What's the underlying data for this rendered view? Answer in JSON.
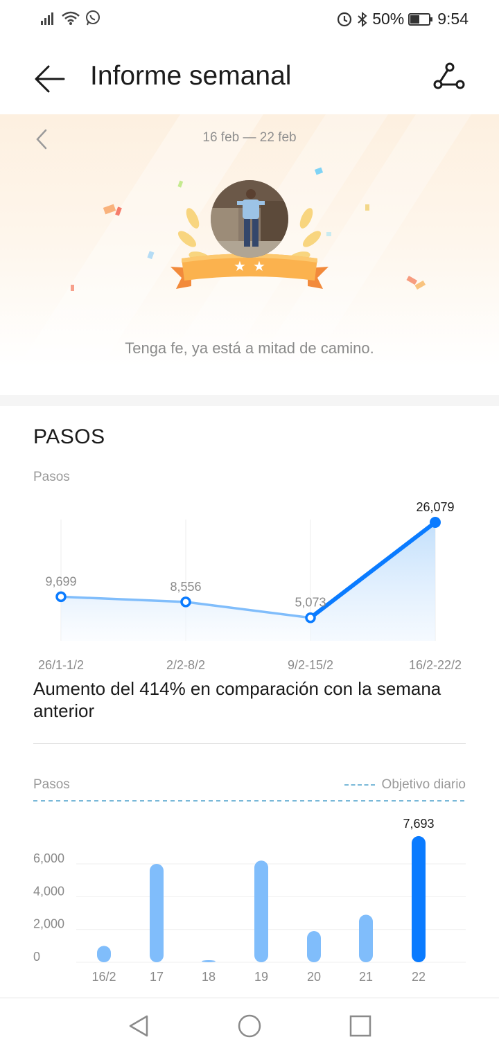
{
  "status_bar": {
    "battery": "50%",
    "time": "9:54",
    "icons": [
      "signal-icon",
      "wifi-icon",
      "whatsapp-icon",
      "data-saver-icon",
      "bluetooth-icon",
      "battery-icon"
    ]
  },
  "header": {
    "title": "Informe semanal",
    "back_icon": "arrow-left-icon",
    "share_icon": "route-share-icon"
  },
  "banner": {
    "date_range": "16 feb — 22 feb",
    "stars_earned": 2,
    "message": "Tenga fe, ya está a mitad de camino."
  },
  "steps_section": {
    "title": "PASOS",
    "line_unit": "Pasos",
    "comparison": "Aumento del 414% en comparación con la semana anterior",
    "bar_unit": "Pasos",
    "goal_legend": "Objetivo diario"
  },
  "chart_data": [
    {
      "type": "line",
      "ylabel": "Pasos",
      "categories": [
        "26/1-1/2",
        "2/2-8/2",
        "9/2-15/2",
        "16/2-22/2"
      ],
      "values": [
        9699,
        8556,
        5073,
        26079
      ],
      "value_labels": [
        "9,699",
        "8,556",
        "5,073",
        "26,079"
      ],
      "highlight_index": 3
    },
    {
      "type": "bar",
      "ylabel": "Pasos",
      "categories": [
        "16/2",
        "17",
        "18",
        "19",
        "20",
        "21",
        "22"
      ],
      "values": [
        1000,
        6000,
        50,
        6200,
        1900,
        2900,
        7693
      ],
      "highlight_index": 6,
      "highlight_label": "7,693",
      "y_ticks": [
        0,
        2000,
        4000,
        6000
      ],
      "y_tick_labels": [
        "0",
        "2,000",
        "4,000",
        "6,000"
      ],
      "ylim": [
        0,
        8500
      ],
      "daily_goal_line": "dashed",
      "colors": {
        "normal": "#80bdfb",
        "highlight": "#0a7bff"
      }
    }
  ],
  "colors": {
    "accent": "#0a7bff",
    "accent_light": "#80bdfb",
    "banner_ribbon": "#fbb24e"
  }
}
